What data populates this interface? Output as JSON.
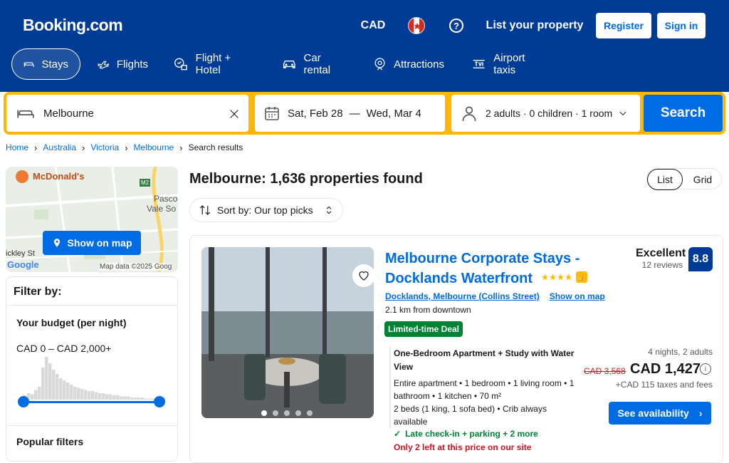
{
  "header": {
    "logo": "Booking.com",
    "currency": "CAD",
    "help_symbol": "?",
    "list_property": "List your property",
    "register": "Register",
    "sign_in": "Sign in",
    "nav": [
      {
        "label": "Stays",
        "icon": "bed-icon",
        "active": true
      },
      {
        "label": "Flights",
        "icon": "plane-icon"
      },
      {
        "label": "Flight + Hotel",
        "icon": "flight-hotel-icon"
      },
      {
        "label": "Car rental",
        "icon": "car-icon"
      },
      {
        "label": "Attractions",
        "icon": "attractions-icon"
      },
      {
        "label": "Airport taxis",
        "icon": "taxi-icon"
      }
    ]
  },
  "search": {
    "destination": "Melbourne",
    "check_in": "Sat, Feb 28",
    "dash": "—",
    "check_out": "Wed, Mar 4",
    "guests": "2 adults · 0 children · 1 room",
    "button": "Search"
  },
  "breadcrumb": [
    "Home",
    "Australia",
    "Victoria",
    "Melbourne",
    "Search results"
  ],
  "map": {
    "button": "Show on map",
    "mcdonalds": "McDonald's",
    "place1": "Pasco",
    "place2": "Vale So",
    "place3": "ickley St",
    "road": "M2",
    "attribution": "Map data ©2025 Goog",
    "google": "Google"
  },
  "filters": {
    "title": "Filter by:",
    "budget_title": "Your budget (per night)",
    "budget_range": "CAD 0 – CAD 2,000+",
    "popular": "Popular filters",
    "histogram": [
      4,
      6,
      5,
      9,
      12,
      30,
      40,
      34,
      28,
      24,
      20,
      18,
      16,
      14,
      12,
      11,
      10,
      9,
      8,
      8,
      7,
      6,
      6,
      5,
      5,
      4,
      4,
      3,
      3,
      3,
      2,
      2,
      2,
      2,
      1,
      1,
      1,
      2,
      3,
      2
    ]
  },
  "results": {
    "title": "Melbourne: 1,636 properties found",
    "view_list": "List",
    "view_grid": "Grid",
    "sort": "Sort by: Our top picks"
  },
  "property": {
    "name": "Melbourne Corporate Stays - Docklands Waterfront",
    "star_count": 4,
    "location": "Docklands, Melbourne (Collins Street)",
    "show_on_map": "Show on map",
    "distance": "2.1 km from downtown",
    "deal": "Limited-time Deal",
    "rating_label": "Excellent",
    "reviews": "12 reviews",
    "score": "8.8",
    "room_title": "One-Bedroom Apartment + Study with Water View",
    "room_details_1": "Entire apartment • 1 bedroom • 1 living room • 1 bathroom • 1 kitchen • 70 m²",
    "room_details_2": "2 beds (1 king, 1 sofa bed) • Crib always available",
    "perk": "Late check-in + parking + 2 more",
    "scarcity": "Only 2 left at this price on our site",
    "stay": "4 nights, 2 adults",
    "old_price": "CAD 3,568",
    "price": "CAD 1,427",
    "taxes": "+CAD 115 taxes and fees",
    "cta": "See availability",
    "photo_count": 5,
    "photo_index": 1
  },
  "colors": {
    "brand_blue": "#003b95",
    "link_blue": "#006ce4",
    "search_yellow": "#ffb700",
    "deal_green": "#008234",
    "scarcity_red": "#d4111e"
  }
}
